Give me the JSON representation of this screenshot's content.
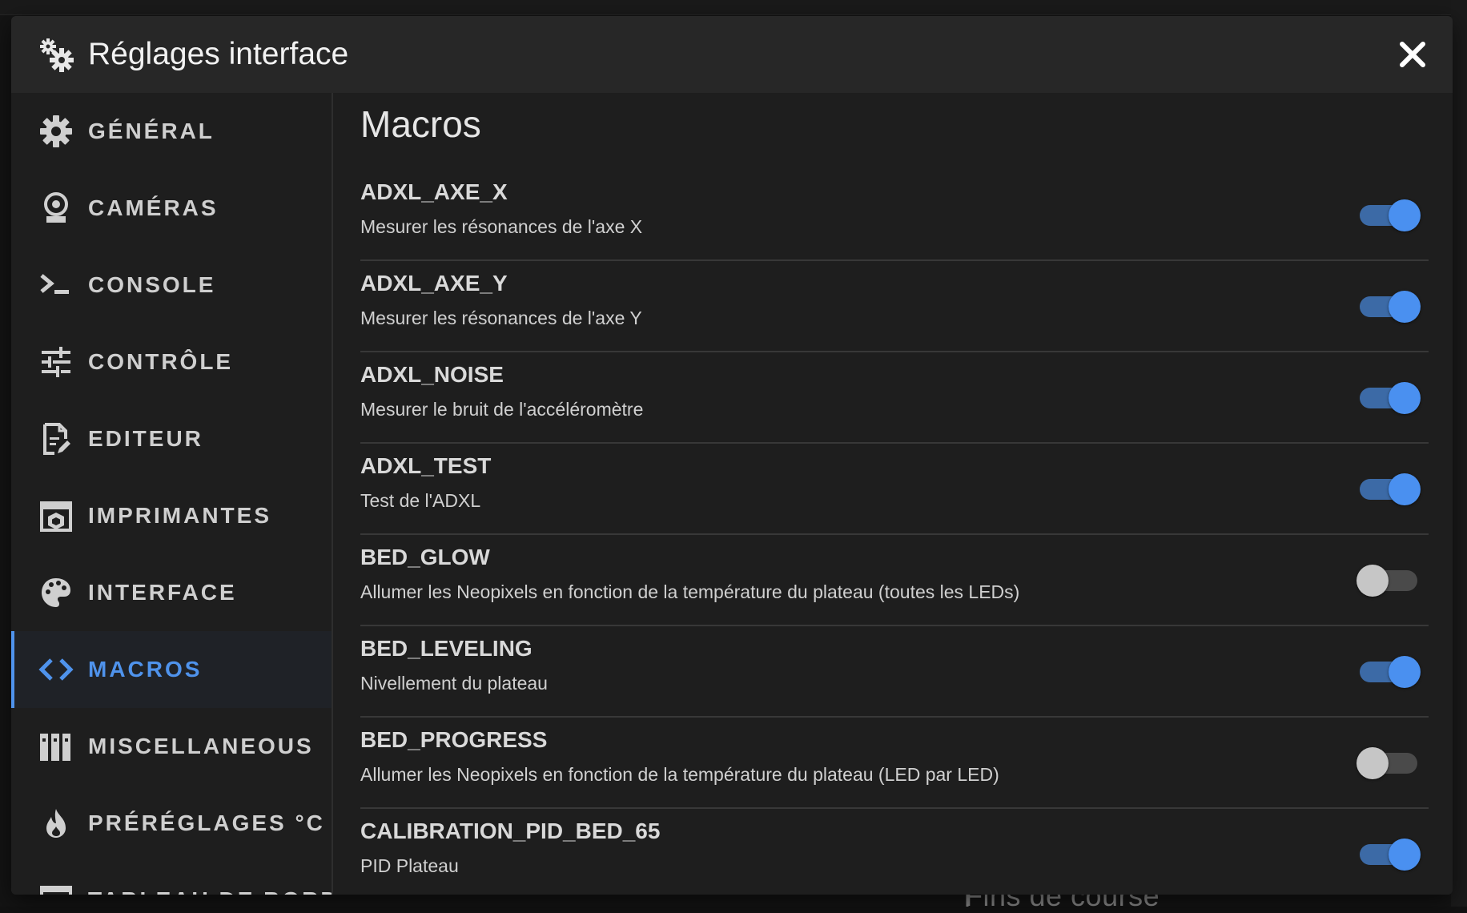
{
  "background": {
    "bottom_text": "Fins de course"
  },
  "dialog": {
    "title": "Réglages interface",
    "header_icon": "gears-icon",
    "close_icon": "close-icon"
  },
  "sidebar": {
    "items": [
      {
        "label": "GÉNÉRAL",
        "icon": "gear-icon",
        "active": false
      },
      {
        "label": "CAMÉRAS",
        "icon": "webcam-icon",
        "active": false
      },
      {
        "label": "CONSOLE",
        "icon": "console-icon",
        "active": false
      },
      {
        "label": "CONTRÔLE",
        "icon": "sliders-icon",
        "active": false
      },
      {
        "label": "EDITEUR",
        "icon": "file-edit-icon",
        "active": false
      },
      {
        "label": "IMPRIMANTES",
        "icon": "printer-3d-icon",
        "active": false
      },
      {
        "label": "INTERFACE",
        "icon": "palette-icon",
        "active": false
      },
      {
        "label": "MACROS",
        "icon": "code-brackets-icon",
        "active": true
      },
      {
        "label": "MISCELLANEOUS",
        "icon": "library-icon",
        "active": false
      },
      {
        "label": "PRÉRÉGLAGES °C",
        "icon": "fire-icon",
        "active": false
      },
      {
        "label": "TABLEAU DE BORD",
        "icon": "dashboard-icon",
        "active": false
      }
    ]
  },
  "content": {
    "title": "Macros",
    "macros": [
      {
        "name": "ADXL_AXE_X",
        "description": "Mesurer les résonances de l'axe X",
        "enabled": true
      },
      {
        "name": "ADXL_AXE_Y",
        "description": "Mesurer les résonances de l'axe Y",
        "enabled": true
      },
      {
        "name": "ADXL_NOISE",
        "description": "Mesurer le bruit de l'accéléromètre",
        "enabled": true
      },
      {
        "name": "ADXL_TEST",
        "description": "Test de l'ADXL",
        "enabled": true
      },
      {
        "name": "BED_GLOW",
        "description": "Allumer les Neopixels en fonction de la température du plateau (toutes les LEDs)",
        "enabled": false
      },
      {
        "name": "BED_LEVELING",
        "description": "Nivellement du plateau",
        "enabled": true
      },
      {
        "name": "BED_PROGRESS",
        "description": "Allumer les Neopixels en fonction de la température du plateau (LED par LED)",
        "enabled": false
      },
      {
        "name": "CALIBRATION_PID_BED_65",
        "description": "PID Plateau",
        "enabled": true
      }
    ]
  },
  "colors": {
    "accent": "#4f93ec",
    "toggle_on_track": "#3c6aa6",
    "toggle_on_thumb": "#4a90f0",
    "toggle_off_thumb": "#c6c6c6"
  }
}
